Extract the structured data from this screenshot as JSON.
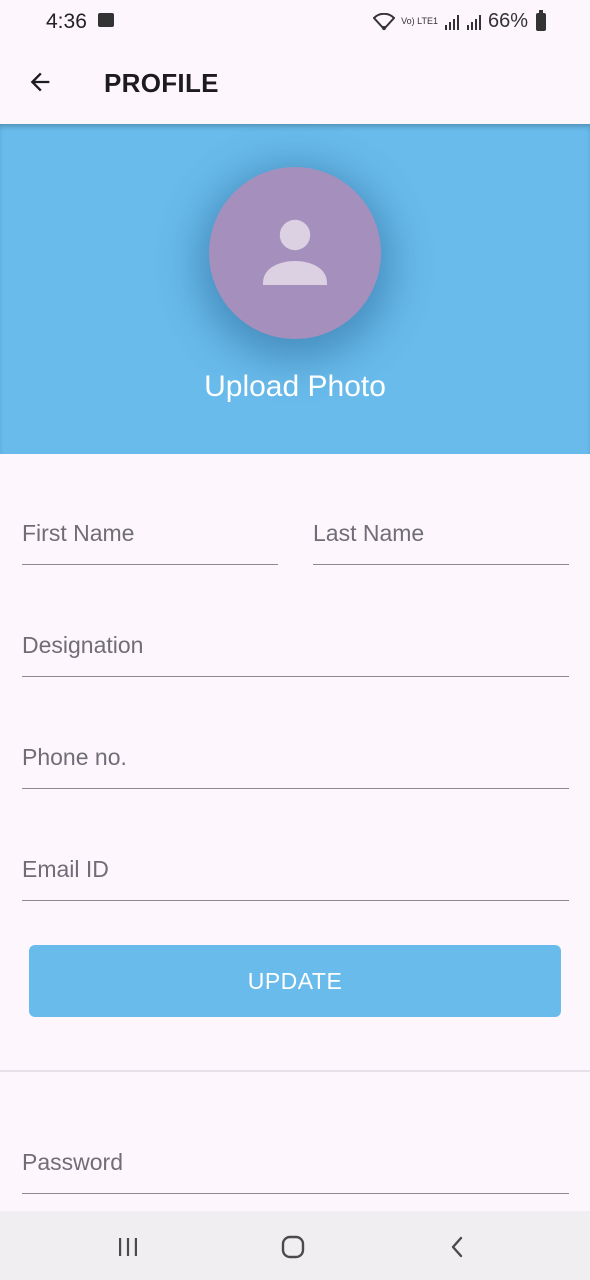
{
  "status_bar": {
    "time": "4:36",
    "network_label": "Vo) LTE1",
    "battery_percent": "66%"
  },
  "app_bar": {
    "title": "PROFILE"
  },
  "header": {
    "upload_label": "Upload Photo",
    "banner_color": "#69bbeb",
    "avatar_color": "#a590bd"
  },
  "form": {
    "first_name_label": "First Name",
    "last_name_label": "Last Name",
    "designation_label": "Designation",
    "phone_label": "Phone no.",
    "email_label": "Email ID",
    "update_label": "UPDATE",
    "password_label": "Password"
  },
  "icons": {
    "back": "arrow-back-icon",
    "avatar": "person-icon",
    "recents": "recents-icon",
    "home": "home-icon",
    "back_nav": "back-nav-icon"
  }
}
